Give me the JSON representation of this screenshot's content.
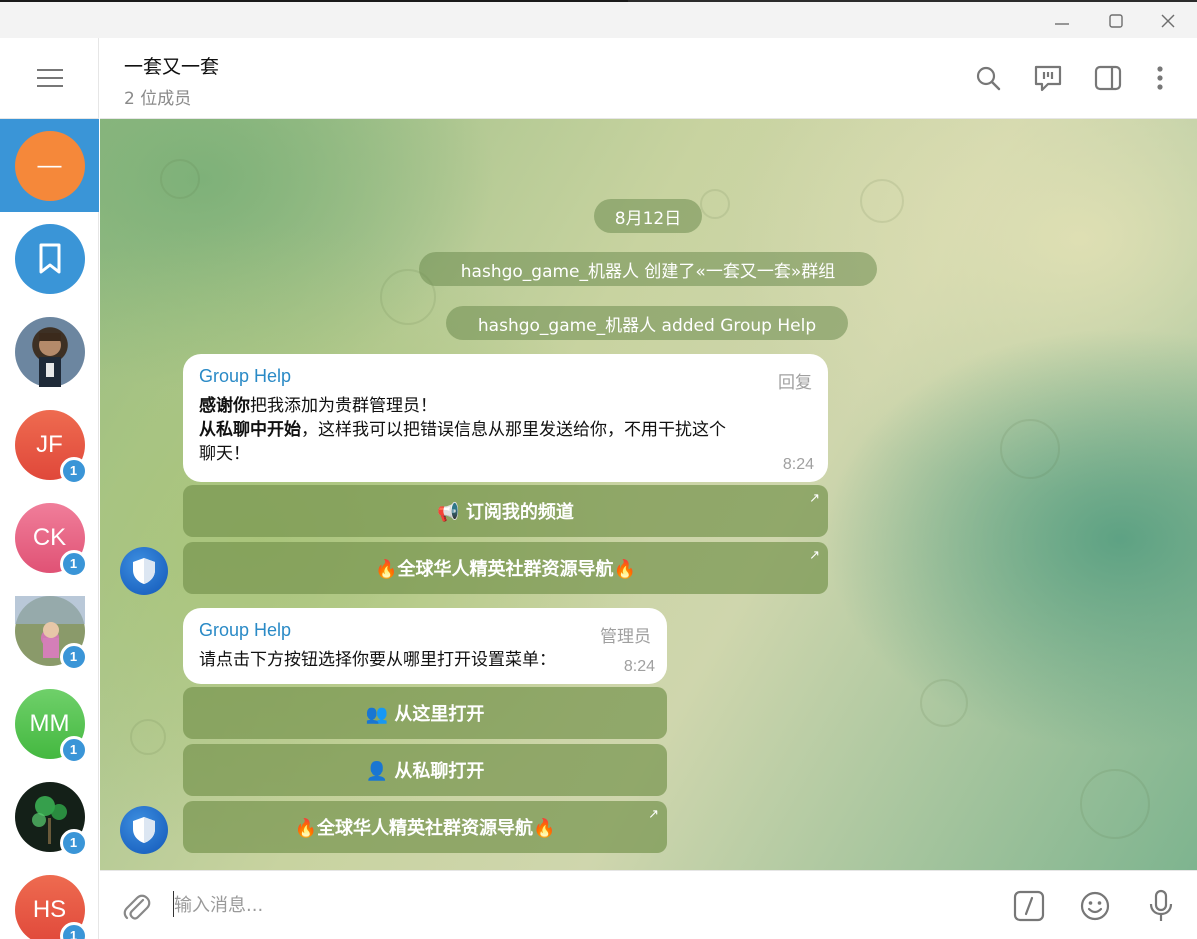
{
  "window": {
    "minimize_icon": "minimize-icon",
    "maximize_icon": "maximize-icon",
    "close_icon": "close-icon"
  },
  "sidebar": {
    "menu_icon": "hamburger-icon",
    "chats": [
      {
        "initials": "—",
        "color": "#f5883a",
        "unread": ""
      },
      {
        "initials": "",
        "color": "#3a95d7",
        "unread": "",
        "icon": "bookmark-icon"
      },
      {
        "initials": "",
        "color": "#4a6a8a",
        "unread": "",
        "icon": "photo-avatar"
      },
      {
        "initials": "JF",
        "color": "#e5533e",
        "unread": "1"
      },
      {
        "initials": "CK",
        "color": "#e85b7a",
        "unread": "1"
      },
      {
        "initials": "",
        "color": "#7a8a5a",
        "unread": "1",
        "icon": "photo-avatar"
      },
      {
        "initials": "MM",
        "color": "#4cbf4c",
        "unread": "1"
      },
      {
        "initials": "",
        "color": "#1a2a1a",
        "unread": "1",
        "icon": "photo-avatar"
      },
      {
        "initials": "HS",
        "color": "#e5533e",
        "unread": "1"
      }
    ]
  },
  "header": {
    "title": "一套又一套",
    "subtitle": "2 位成员",
    "icons": [
      "search-icon",
      "live-chat-icon",
      "sidebar-toggle-icon",
      "more-icon"
    ]
  },
  "chat": {
    "date": "8月12日",
    "service_1": "hashgo_game_机器人 创建了«一套又一套»群组",
    "service_2": "hashgo_game_机器人 added Group Help",
    "msg1": {
      "sender": "Group Help",
      "tag": "回复",
      "line1_bold": "感谢你",
      "line1_rest": "把我添加为贵群管理员！",
      "line2_bold": "从私聊中开始",
      "line2_rest": "，这样我可以把错误信息从那里发送给你，不用干扰这个",
      "line3": "聊天！",
      "time": "8:24",
      "buttons": [
        {
          "label": "📢 订阅我的频道",
          "external": "↗"
        },
        {
          "label": "🔥全球华人精英社群资源导航🔥",
          "external": "↗"
        }
      ]
    },
    "msg2": {
      "sender": "Group Help",
      "tag": "管理员",
      "text": "请点击下方按钮选择你要从哪里打开设置菜单：",
      "time": "8:24",
      "buttons": [
        {
          "label": "👥 从这里打开",
          "external": ""
        },
        {
          "label": "👤 从私聊打开",
          "external": ""
        },
        {
          "label": "🔥全球华人精英社群资源导航🔥",
          "external": "↗"
        }
      ]
    }
  },
  "composer": {
    "placeholder": "输入消息...",
    "icons": [
      "attach-icon",
      "bot-command-icon",
      "emoji-icon",
      "microphone-icon"
    ]
  }
}
